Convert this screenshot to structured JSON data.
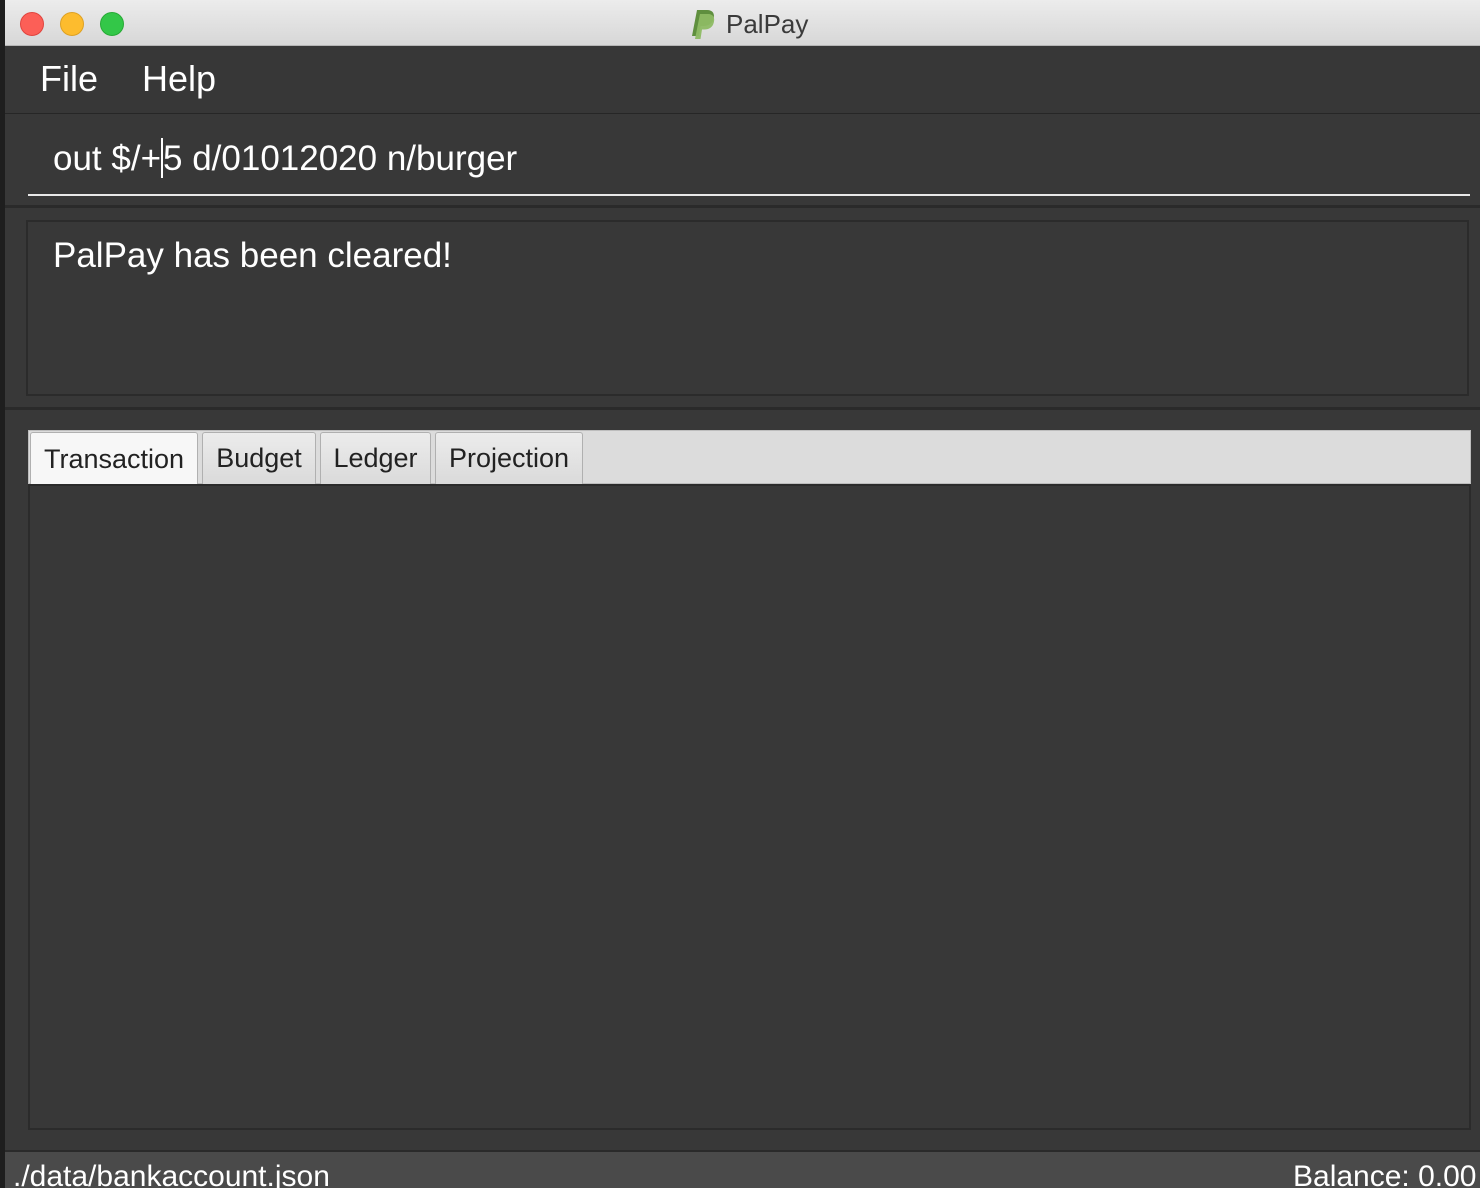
{
  "window": {
    "title": "PalPay"
  },
  "menu": {
    "file_label": "File",
    "help_label": "Help"
  },
  "command": {
    "text_before_cursor": "out $/+",
    "text_after_cursor": "5 d/01012020 n/burger"
  },
  "result": {
    "message": "PalPay has been cleared!"
  },
  "tabs": [
    {
      "label": "Transaction",
      "active": true
    },
    {
      "label": "Budget",
      "active": false
    },
    {
      "label": "Ledger",
      "active": false
    },
    {
      "label": "Projection",
      "active": false
    }
  ],
  "status": {
    "file_path": "./data/bankaccount.json",
    "balance": "Balance: 0.00"
  },
  "icons": {
    "logo": "paypal-logo-icon",
    "close": "close-window-icon",
    "minimize": "minimize-window-icon",
    "zoom": "zoom-window-icon"
  },
  "colors": {
    "background": "#383838",
    "text": "#ffffff",
    "logo_primary": "#5f8f3e",
    "logo_secondary": "#8dbb63",
    "close": "#fc5f57",
    "minimize": "#fdbc2e",
    "zoom": "#33c748"
  }
}
